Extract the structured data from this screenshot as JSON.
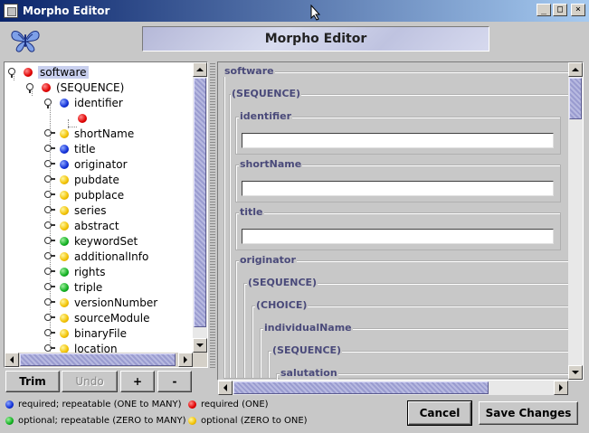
{
  "window": {
    "title": "Morpho Editor",
    "minimize": "_",
    "maximize": "□",
    "close": "×"
  },
  "header": {
    "banner": "Morpho Editor",
    "logo_icon": "butterfly-icon"
  },
  "tree": {
    "items": [
      {
        "label": "software",
        "color": "red",
        "expander": "open",
        "selected": true
      },
      {
        "label": "(SEQUENCE)",
        "color": "red",
        "expander": "open"
      },
      {
        "label": "identifier",
        "color": "blue",
        "expander": "open"
      },
      {
        "label": "",
        "color": "red",
        "expander": "none"
      },
      {
        "label": "shortName",
        "color": "yellow",
        "expander": "closed"
      },
      {
        "label": "title",
        "color": "blue",
        "expander": "closed"
      },
      {
        "label": "originator",
        "color": "blue",
        "expander": "closed"
      },
      {
        "label": "pubdate",
        "color": "yellow",
        "expander": "closed"
      },
      {
        "label": "pubplace",
        "color": "yellow",
        "expander": "closed"
      },
      {
        "label": "series",
        "color": "yellow",
        "expander": "closed"
      },
      {
        "label": "abstract",
        "color": "yellow",
        "expander": "closed"
      },
      {
        "label": "keywordSet",
        "color": "green",
        "expander": "closed"
      },
      {
        "label": "additionalInfo",
        "color": "yellow",
        "expander": "closed"
      },
      {
        "label": "rights",
        "color": "green",
        "expander": "closed"
      },
      {
        "label": "triple",
        "color": "green",
        "expander": "closed"
      },
      {
        "label": "versionNumber",
        "color": "yellow",
        "expander": "closed"
      },
      {
        "label": "sourceModule",
        "color": "yellow",
        "expander": "closed"
      },
      {
        "label": "binaryFile",
        "color": "yellow",
        "expander": "closed"
      },
      {
        "label": "location",
        "color": "yellow",
        "expander": "closed"
      }
    ]
  },
  "tree_buttons": {
    "trim": "Trim",
    "undo": "Undo",
    "add": "+",
    "remove": "-"
  },
  "form": {
    "software": "software",
    "sequence": "(SEQUENCE)",
    "identifier": {
      "label": "identifier",
      "value": ""
    },
    "shortName": {
      "label": "shortName",
      "value": ""
    },
    "title": {
      "label": "title",
      "value": ""
    },
    "originator": "originator",
    "sequence2": "(SEQUENCE)",
    "choice": "(CHOICE)",
    "individualName": "individualName",
    "sequence3": "(SEQUENCE)",
    "salutation": "salutation"
  },
  "legend": {
    "blue": "required; repeatable (ONE to MANY)",
    "red": "required (ONE)",
    "green": "optional; repeatable (ZERO to MANY)",
    "yellow": "optional (ZERO to ONE)"
  },
  "actions": {
    "cancel": "Cancel",
    "save": "Save Changes"
  }
}
